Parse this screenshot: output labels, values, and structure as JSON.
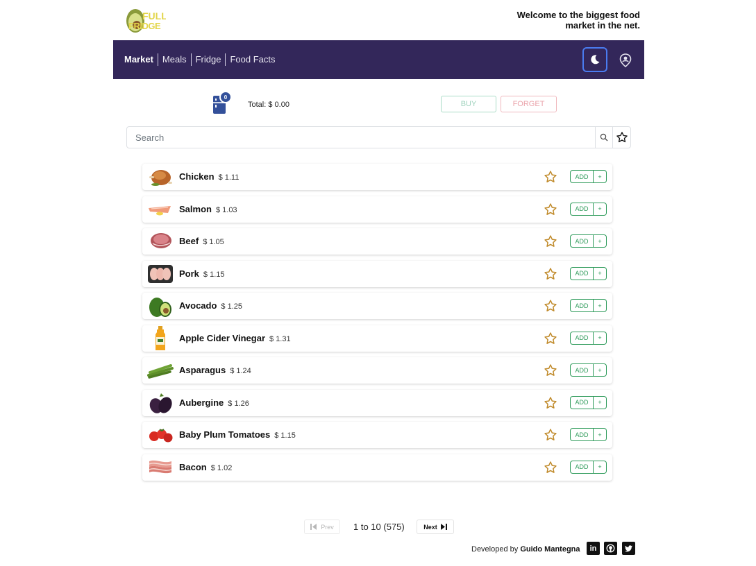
{
  "header": {
    "logo_text_top": "FULL",
    "logo_text_bottom": "FRIDGE",
    "welcome": "Welcome to the biggest food market in the net."
  },
  "nav": {
    "items": [
      "Market",
      "Meals",
      "Fridge",
      "Food Facts"
    ],
    "theme_icon": "moon-icon",
    "user_icon": "user-location-icon"
  },
  "cart": {
    "count": "0",
    "total": "Total: $ 0.00",
    "buy_label": "BUY",
    "forget_label": "FORGET"
  },
  "search": {
    "placeholder": "Search",
    "value": ""
  },
  "products": [
    {
      "name": "Chicken",
      "price": "$ 1.11",
      "icon": "chicken-icon"
    },
    {
      "name": "Salmon",
      "price": "$ 1.03",
      "icon": "salmon-icon"
    },
    {
      "name": "Beef",
      "price": "$ 1.05",
      "icon": "beef-icon"
    },
    {
      "name": "Pork",
      "price": "$ 1.15",
      "icon": "pork-icon"
    },
    {
      "name": "Avocado",
      "price": "$ 1.25",
      "icon": "avocado-icon"
    },
    {
      "name": "Apple Cider Vinegar",
      "price": "$ 1.31",
      "icon": "vinegar-bottle-icon"
    },
    {
      "name": "Asparagus",
      "price": "$ 1.24",
      "icon": "asparagus-icon"
    },
    {
      "name": "Aubergine",
      "price": "$ 1.26",
      "icon": "aubergine-icon"
    },
    {
      "name": "Baby Plum Tomatoes",
      "price": "$ 1.15",
      "icon": "tomatoes-icon"
    },
    {
      "name": "Bacon",
      "price": "$ 1.02",
      "icon": "bacon-icon"
    }
  ],
  "product_actions": {
    "add_label": "ADD",
    "plus_label": "+"
  },
  "pagination": {
    "prev_label": "Prev",
    "next_label": "Next",
    "range": "1 to 10 (575)"
  },
  "footer": {
    "prefix": "Developed by",
    "author": "Guido Mantegna",
    "social_icons": [
      "linkedin-icon",
      "github-icon",
      "twitter-icon"
    ]
  },
  "colors": {
    "navbar": "#33275a",
    "accent_green": "#2e9b5a",
    "star": "#c08a2a",
    "badge": "#33509a"
  }
}
